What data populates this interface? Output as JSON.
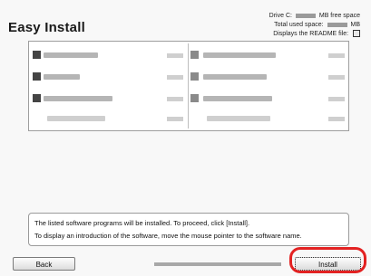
{
  "window": {
    "title": "Easy Install"
  },
  "info": {
    "drive_prefix": "Drive C:",
    "drive_suffix": "MB free space",
    "used_prefix": "Total used space:",
    "used_suffix": "MB",
    "readme_label": "Displays the README file:"
  },
  "message": {
    "line1": "The listed software programs will be installed. To proceed, click [Install].",
    "line2": "To display an introduction of the software, move the mouse pointer to the software name."
  },
  "buttons": {
    "back": "Back",
    "install": "Install"
  },
  "colors": {
    "highlight": "#e32222"
  }
}
